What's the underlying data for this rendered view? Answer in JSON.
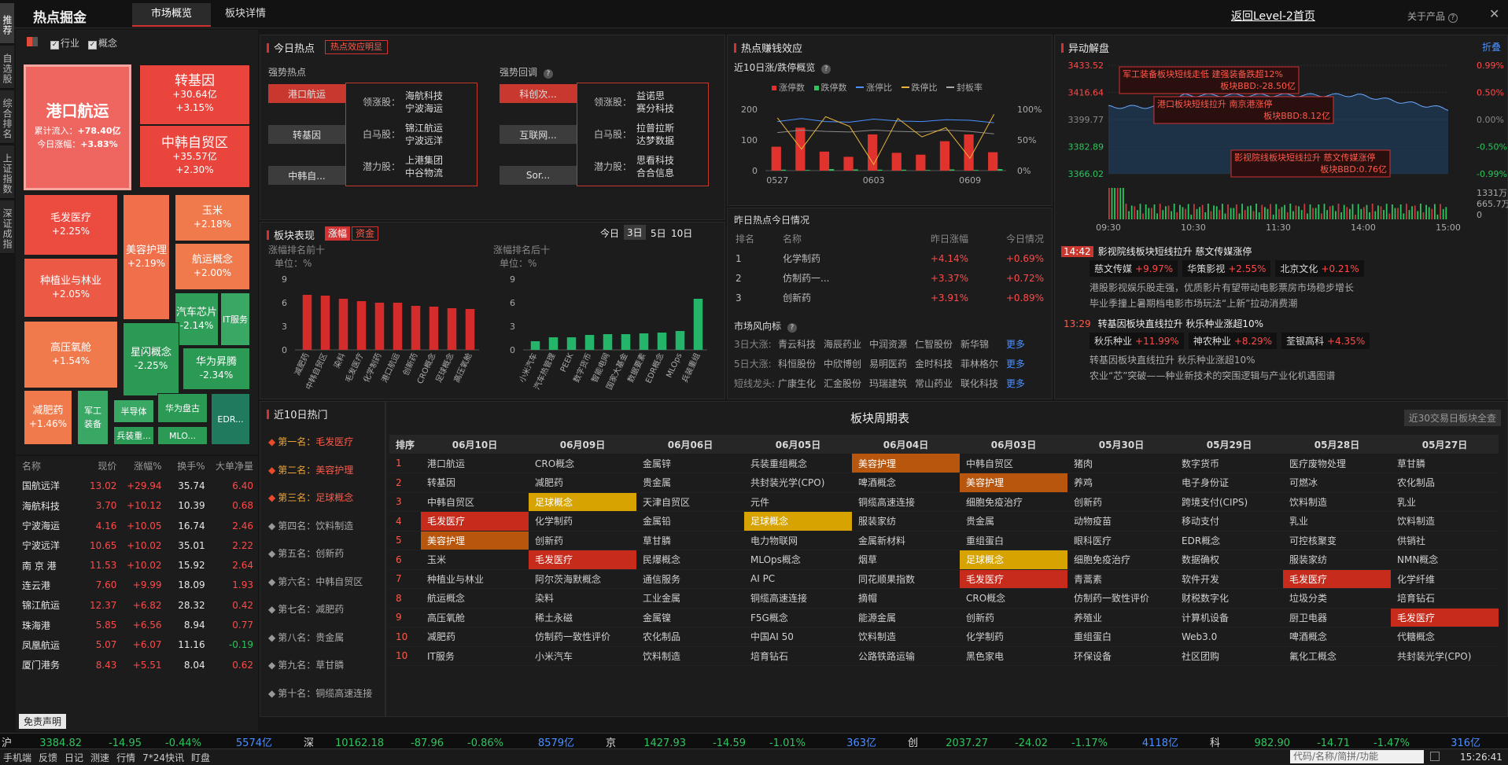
{
  "app": {
    "title": "热点掘金",
    "tabs": [
      "市场概览",
      "板块详情"
    ],
    "back_link": "返回Level-2首页",
    "about": "关于产品"
  },
  "left_tabs": [
    "推荐",
    "自选股",
    "综合排名",
    "上证指数",
    "深证成指"
  ],
  "filters": {
    "industry": "行业",
    "concept": "概念"
  },
  "heatmap": {
    "main": {
      "name": "港口航运",
      "inflow_label": "累计流入：",
      "inflow": "+78.40亿",
      "change_label": "今日涨幅：",
      "change": "+3.83%"
    },
    "tiles": [
      {
        "name": "转基因",
        "l1": "+30.64亿",
        "l2": "+3.15%"
      },
      {
        "name": "中韩自贸区",
        "l1": "+35.57亿",
        "l2": "+2.30%"
      },
      {
        "name": "毛发医疗",
        "l1": "+2.25%"
      },
      {
        "name": "美容护理",
        "l1": "+2.19%"
      },
      {
        "name": "玉米",
        "l1": "+2.18%"
      },
      {
        "name": "航运概念",
        "l1": "+2.00%"
      },
      {
        "name": "种植业与林业",
        "l1": "+2.05%"
      },
      {
        "name": "汽车芯片",
        "l1": "-2.14%"
      },
      {
        "name": "IT服务"
      },
      {
        "name": "高压氧舱",
        "l1": "+1.54%"
      },
      {
        "name": "星闪概念",
        "l1": "-2.25%"
      },
      {
        "name": "华为昇腾",
        "l1": "-2.34%"
      },
      {
        "name": "减肥药",
        "l1": "+1.46%"
      },
      {
        "name": "军工装备"
      },
      {
        "name": "半导体"
      },
      {
        "name": "华为盘古"
      },
      {
        "name": "EDR..."
      },
      {
        "name": "兵装重..."
      },
      {
        "name": "MLO..."
      }
    ]
  },
  "stock_table": {
    "headers": [
      "名称",
      "现价",
      "涨幅%",
      "换手%",
      "大单净量"
    ],
    "rows": [
      [
        "国航远洋",
        "13.02",
        "+29.94",
        "35.74",
        "6.40"
      ],
      [
        "海航科技",
        "3.70",
        "+10.12",
        "10.39",
        "0.68"
      ],
      [
        "宁波海运",
        "4.16",
        "+10.05",
        "16.74",
        "2.46"
      ],
      [
        "宁波远洋",
        "10.65",
        "+10.02",
        "35.01",
        "2.22"
      ],
      [
        "南 京 港",
        "11.53",
        "+10.02",
        "15.92",
        "2.64"
      ],
      [
        "连云港",
        "7.60",
        "+9.99",
        "18.09",
        "1.93"
      ],
      [
        "锦江航运",
        "12.37",
        "+6.82",
        "28.32",
        "0.42"
      ],
      [
        "珠海港",
        "5.85",
        "+6.56",
        "8.94",
        "0.77"
      ],
      [
        "凤凰航运",
        "5.07",
        "+6.07",
        "11.16",
        "-0.19"
      ],
      [
        "厦门港务",
        "8.43",
        "+5.51",
        "8.04",
        "0.62"
      ]
    ],
    "disclaimer": "免责声明"
  },
  "today_hot": {
    "title": "今日热点",
    "badge": "热点效应明显",
    "strong_label": "强势热点",
    "pullback_label": "强势回调",
    "strong_items": [
      "港口航运",
      "转基因",
      "中韩自..."
    ],
    "pullback_items": [
      "科创次...",
      "互联网...",
      "Sor..."
    ],
    "strong_detail": [
      {
        "k": "领涨股：",
        "v": [
          "海航科技",
          "宁波海运"
        ]
      },
      {
        "k": "白马股：",
        "v": [
          "锦江航运",
          "宁波远洋"
        ]
      },
      {
        "k": "潜力股：",
        "v": [
          "上港集团",
          "中谷物流"
        ]
      }
    ],
    "pullback_detail": [
      {
        "k": "领涨股：",
        "v": [
          "益诺思",
          "赛分科技"
        ]
      },
      {
        "k": "白马股：",
        "v": [
          "拉普拉斯",
          "达梦数据"
        ]
      },
      {
        "k": "潜力股：",
        "v": [
          "思看科技",
          "合合信息"
        ]
      }
    ]
  },
  "profit_effect": {
    "title": "热点赚钱效应",
    "sub": "近10日涨/跌停概览",
    "legend": [
      "涨停数",
      "跌停数",
      "涨停比",
      "跌停比",
      "封板率"
    ],
    "yleft": [
      "200",
      "100",
      "0"
    ],
    "yright": [
      "100%",
      "50%",
      "0%"
    ],
    "xlabels": [
      "0527",
      "0603",
      "0609"
    ]
  },
  "chart_data": [
    {
      "type": "bar",
      "title": "近10日涨/跌停概览",
      "series": [
        {
          "name": "涨停数",
          "values": [
            78,
            140,
            62,
            45,
            118,
            58,
            52,
            96,
            118,
            60
          ]
        },
        {
          "name": "跌停数",
          "values": [
            3,
            2,
            5,
            4,
            3,
            3,
            2,
            4,
            2,
            5
          ]
        }
      ],
      "ylim": [
        0,
        200
      ]
    },
    {
      "type": "bar",
      "title": "涨幅排名前十",
      "ylabel": "单位：%",
      "categories": [
        "减肥药",
        "中韩自贸区",
        "染料",
        "毛发医疗",
        "化学制药",
        "港口航运",
        "创新药",
        "CRO概念",
        "足球概念",
        "高压氧舱"
      ],
      "values": [
        7,
        6.9,
        6.5,
        6.2,
        6,
        6,
        5.6,
        5.5,
        5.3,
        5.2
      ],
      "ylim": [
        0,
        9
      ]
    },
    {
      "type": "bar",
      "title": "涨幅排名后十",
      "ylabel": "单位：%",
      "categories": [
        "小米汽车",
        "汽车热管理",
        "PEEK",
        "数字货币",
        "智能电网",
        "国家大基金",
        "数据要素",
        "EDR概念",
        "MLOps",
        "兵装重组"
      ],
      "values": [
        1.1,
        1.6,
        1.6,
        1.9,
        2.0,
        2.0,
        2.1,
        2.2,
        2.4,
        6.5
      ],
      "ylim": [
        0,
        9
      ]
    }
  ],
  "yesterday_hot": {
    "title": "昨日热点今日情况",
    "headers": [
      "排名",
      "名称",
      "昨日涨幅",
      "今日情况"
    ],
    "rows": [
      [
        "1",
        "化学制药",
        "+4.14%",
        "+0.69%"
      ],
      [
        "2",
        "仿制药一...",
        "+3.37%",
        "+0.72%"
      ],
      [
        "3",
        "创新药",
        "+3.91%",
        "+0.89%"
      ]
    ]
  },
  "market_wind": {
    "title": "市场风向标",
    "rows": [
      {
        "k": "3日大涨:",
        "v": [
          "青云科技",
          "海辰药业",
          "中润资源",
          "仁智股份",
          "新华锦"
        ]
      },
      {
        "k": "5日大涨:",
        "v": [
          "科恒股份",
          "中欣博创",
          "易明医药",
          "金时科技",
          "菲林格尔"
        ]
      },
      {
        "k": "短线龙头:",
        "v": [
          "广康生化",
          "汇金股份",
          "玛瑞建筑",
          "常山药业",
          "联化科技"
        ]
      }
    ],
    "more": "更多"
  },
  "sector_perf": {
    "title": "板块表现",
    "tabs": [
      "涨幅",
      "资金"
    ],
    "periods": [
      "今日",
      "3日",
      "5日",
      "10日"
    ],
    "left_label": "涨幅排名前十",
    "right_label": "涨幅排名后十",
    "unit": "单位：%",
    "yticks": [
      "9",
      "6",
      "3",
      "0"
    ]
  },
  "anomaly": {
    "title": "异动解盘",
    "fold": "折叠",
    "prices": [
      "3433.52",
      "3416.64",
      "3399.77",
      "3382.89",
      "3366.02"
    ],
    "pcts": [
      "0.99%",
      "0.50%",
      "0.00%",
      "-0.50%",
      "-0.99%"
    ],
    "vols": [
      "1331万",
      "665.7万",
      "0"
    ],
    "times": [
      "09:30",
      "10:30",
      "11:30",
      "14:00",
      "15:00"
    ],
    "notes": [
      {
        "t": "军工装备板块短线走低 建强装备跌超12%",
        "b": "板块BBD:-28.50亿"
      },
      {
        "t": "港口板块短线拉升 南京港涨停",
        "b": "板块BBD:8.12亿"
      },
      {
        "t": "影视院线板块短线拉升 慈文传媒涨停",
        "b": "板块BBD:0.76亿"
      }
    ],
    "news": [
      {
        "time": "14:42",
        "title": "影视院线板块短线拉升 慈文传媒涨停",
        "tags": [
          [
            "慈文传媒",
            "+9.97%"
          ],
          [
            "华策影视",
            "+2.55%"
          ],
          [
            "北京文化",
            "+0.21%"
          ]
        ],
        "lines": [
          "港股影视娱乐股走强，优质影片有望带动电影票房市场稳步增长",
          "毕业季撞上暑期档电影市场玩法“上新”拉动消费潮"
        ]
      },
      {
        "time": "13:29",
        "title": "转基因板块直线拉升 秋乐种业涨超10%",
        "tags": [
          [
            "秋乐种业",
            "+11.99%"
          ],
          [
            "神农种业",
            "+8.29%"
          ],
          [
            "荃银高科",
            "+4.35%"
          ]
        ],
        "lines": [
          "转基因板块直线拉升 秋乐种业涨超10%",
          "农业“芯”突破——种业新技术的突围逻辑与产业化机遇图谱"
        ]
      }
    ]
  },
  "hot10": {
    "title": "近10日热门",
    "ranks": [
      [
        "第一名：",
        "毛发医疗"
      ],
      [
        "第二名：",
        "美容护理"
      ],
      [
        "第三名：",
        "足球概念"
      ],
      [
        "第四名：",
        "饮料制造"
      ],
      [
        "第五名：",
        "创新药"
      ],
      [
        "第六名：",
        "中韩自贸区"
      ],
      [
        "第七名：",
        "减肥药"
      ],
      [
        "第八名：",
        "贵金属"
      ],
      [
        "第九名：",
        "草甘膦"
      ],
      [
        "第十名：",
        "铜缆高速连接"
      ]
    ]
  },
  "period_table": {
    "title": "板块周期表",
    "button": "近30交易日板块全查",
    "headers": [
      "排序",
      "06月10日",
      "06月09日",
      "06月06日",
      "06月05日",
      "06月04日",
      "06月03日",
      "05月30日",
      "05月29日",
      "05月28日",
      "05月27日"
    ],
    "rows": [
      [
        "1",
        "港口航运",
        "CRO概念",
        "金属锌",
        "兵装重组概念",
        "美容护理",
        "中韩自贸区",
        "猪肉",
        "数字货币",
        "医疗废物处理",
        "草甘膦"
      ],
      [
        "2",
        "转基因",
        "减肥药",
        "贵金属",
        "共封装光学(CPO)",
        "啤酒概念",
        "美容护理",
        "养鸡",
        "电子身份证",
        "可燃冰",
        "农化制品"
      ],
      [
        "3",
        "中韩自贸区",
        "足球概念",
        "天津自贸区",
        "元件",
        "铜缆高速连接",
        "细胞免疫治疗",
        "创新药",
        "跨境支付(CIPS)",
        "饮料制造",
        "乳业"
      ],
      [
        "4",
        "毛发医疗",
        "化学制药",
        "金属铅",
        "足球概念",
        "服装家纺",
        "贵金属",
        "动物疫苗",
        "移动支付",
        "乳业",
        "饮料制造"
      ],
      [
        "5",
        "美容护理",
        "创新药",
        "草甘膦",
        "电力物联网",
        "金属新材料",
        "重组蛋白",
        "眼科医疗",
        "EDR概念",
        "可控核聚变",
        "供销社"
      ],
      [
        "6",
        "玉米",
        "毛发医疗",
        "民爆概念",
        "MLOps概念",
        "烟草",
        "足球概念",
        "细胞免疫治疗",
        "数据确权",
        "服装家纺",
        "NMN概念"
      ],
      [
        "7",
        "种植业与林业",
        "阿尔茨海默概念",
        "通信服务",
        "AI PC",
        "同花顺果指数",
        "毛发医疗",
        "青蒿素",
        "软件开发",
        "毛发医疗",
        "化学纤维"
      ],
      [
        "8",
        "航运概念",
        "染料",
        "工业金属",
        "铜缆高速连接",
        "摘帽",
        "CRO概念",
        "仿制药一致性评价",
        "财税数字化",
        "垃圾分类",
        "培育钻石"
      ],
      [
        "9",
        "高压氧舱",
        "稀土永磁",
        "金属镍",
        "F5G概念",
        "能源金属",
        "创新药",
        "养殖业",
        "计算机设备",
        "厨卫电器",
        "毛发医疗"
      ],
      [
        "10",
        "减肥药",
        "仿制药一致性评价",
        "农化制品",
        "中国AI 50",
        "饮料制造",
        "化学制药",
        "重组蛋白",
        "Web3.0",
        "啤酒概念",
        "代糖概念"
      ],
      [
        "10",
        "IT服务",
        "小米汽车",
        "饮料制造",
        "培育钻石",
        "公路铁路运输",
        "黑色家电",
        "环保设备",
        "社区团购",
        "氟化工概念",
        "共封装光学(CPO)"
      ]
    ]
  },
  "ticker": [
    {
      "k": "沪",
      "p": "3384.82",
      "c": "-14.95",
      "pc": "-0.44%",
      "v": "5574亿"
    },
    {
      "k": "深",
      "p": "10162.18",
      "c": "-87.96",
      "pc": "-0.86%",
      "v": "8579亿"
    },
    {
      "k": "京",
      "p": "1427.93",
      "c": "-14.59",
      "pc": "-1.01%",
      "v": "363亿"
    },
    {
      "k": "创",
      "p": "2037.27",
      "c": "-24.02",
      "pc": "-1.17%",
      "v": "4118亿"
    },
    {
      "k": "科",
      "p": "982.90",
      "c": "-14.71",
      "pc": "-1.47%",
      "v": "316亿"
    }
  ],
  "statusbar": {
    "items": [
      "手机端",
      "反馈",
      "日记",
      "测速",
      "行情",
      "7*24快讯",
      "盯盘"
    ],
    "search": "代码/名称/简拼/功能",
    "time": "15:26:41"
  },
  "colors": {
    "up": "#ff4a4a",
    "down": "#2fc45e",
    "accent": "#d23232"
  }
}
